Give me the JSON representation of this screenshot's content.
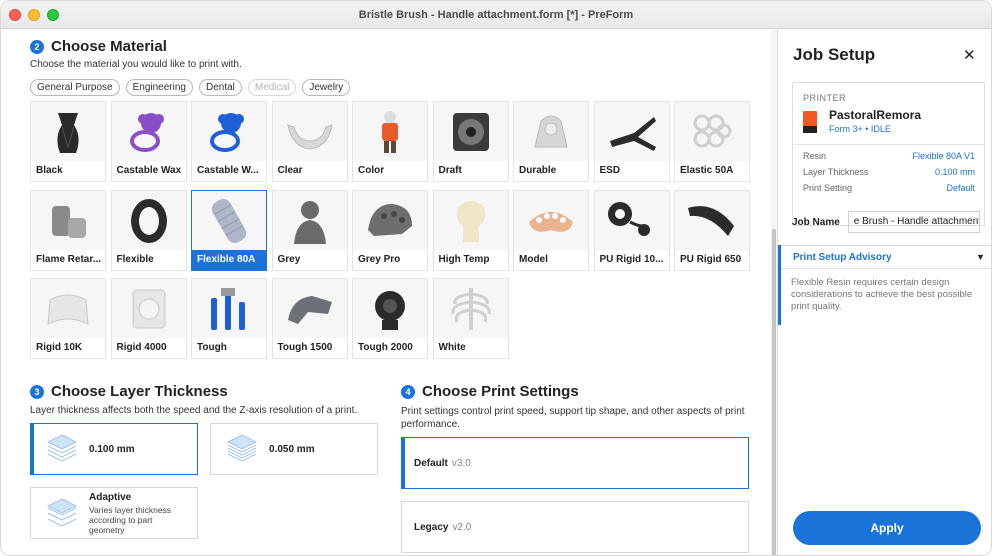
{
  "window": {
    "title": "Bristle Brush - Handle attachment.form [*] - PreForm"
  },
  "material": {
    "step": "2",
    "heading": "Choose Material",
    "description": "Choose the material you would like to print with.",
    "categories": [
      {
        "label": "General Purpose",
        "enabled": true
      },
      {
        "label": "Engineering",
        "enabled": true
      },
      {
        "label": "Dental",
        "enabled": true
      },
      {
        "label": "Medical",
        "enabled": false
      },
      {
        "label": "Jewelry",
        "enabled": true
      }
    ],
    "items": [
      {
        "label": "Black",
        "icon": "vase-icon",
        "color": "#2a2a2a"
      },
      {
        "label": "Castable Wax",
        "icon": "ring-icon",
        "color": "#8a4ec7"
      },
      {
        "label": "Castable W...",
        "icon": "ring-icon",
        "color": "#1f5fd6"
      },
      {
        "label": "Clear",
        "icon": "jaw-icon",
        "color": "#d8d8d8"
      },
      {
        "label": "Color",
        "icon": "figure-icon",
        "color": "#e85a2a"
      },
      {
        "label": "Draft",
        "icon": "fan-icon",
        "color": "#3a3a3a"
      },
      {
        "label": "Durable",
        "icon": "part-icon",
        "color": "#d6d6d6"
      },
      {
        "label": "ESD",
        "icon": "clip-icon",
        "color": "#2b2b2b"
      },
      {
        "label": "Elastic 50A",
        "icon": "lattice-icon",
        "color": "#cfcfcf"
      },
      {
        "label": "Flame Retar...",
        "icon": "block-icon",
        "color": "#8a8a8a"
      },
      {
        "label": "Flexible",
        "icon": "tire-icon",
        "color": "#2b2b2b"
      },
      {
        "label": "Flexible 80A",
        "icon": "tube-icon",
        "color": "#aeb6c8"
      },
      {
        "label": "Grey",
        "icon": "bust-icon",
        "color": "#6a6a6a"
      },
      {
        "label": "Grey Pro",
        "icon": "helmet-icon",
        "color": "#6e6e6e"
      },
      {
        "label": "High Temp",
        "icon": "bulb-icon",
        "color": "#efe6c8"
      },
      {
        "label": "Model",
        "icon": "teeth-icon",
        "color": "#e8b48f"
      },
      {
        "label": "PU Rigid 10...",
        "icon": "cable-icon",
        "color": "#2b2b2b"
      },
      {
        "label": "PU Rigid 650",
        "icon": "chain-icon",
        "color": "#2b2b2b"
      },
      {
        "label": "Rigid 10K",
        "icon": "bracket-icon",
        "color": "#e6e6e6"
      },
      {
        "label": "Rigid 4000",
        "icon": "grille-icon",
        "color": "#e6e6e6"
      },
      {
        "label": "Tough",
        "icon": "tools-icon",
        "color": "#1f5fd6"
      },
      {
        "label": "Tough 1500",
        "icon": "handle-icon",
        "color": "#6e7078"
      },
      {
        "label": "Tough 2000",
        "icon": "pump-icon",
        "color": "#2b2b2b"
      },
      {
        "label": "White",
        "icon": "ribcage-icon",
        "color": "#e8e8e8"
      }
    ],
    "selected": "Flexible 80A"
  },
  "layer": {
    "step": "3",
    "heading": "Choose Layer Thickness",
    "description": "Layer thickness affects both the speed and the Z-axis resolution of a print.",
    "options": [
      {
        "label": "0.100 mm",
        "selected": true
      },
      {
        "label": "0.050 mm",
        "selected": false
      }
    ],
    "adaptive": {
      "label": "Adaptive",
      "description": "Varies layer thickness according to part geometry"
    }
  },
  "print_settings": {
    "step": "4",
    "heading": "Choose Print Settings",
    "description": "Print settings control print speed, support tip shape, and other aspects of print performance.",
    "options": [
      {
        "name": "Default",
        "version": "v3.0",
        "selected": true
      },
      {
        "name": "Legacy",
        "version": "v2.0",
        "selected": false
      }
    ]
  },
  "job_setup": {
    "heading": "Job Setup",
    "close": "✕",
    "printer_caption": "PRINTER",
    "printer_name": "PastoralRemora",
    "printer_status": "Form 3+ • IDLE",
    "rows": [
      {
        "k": "Resin",
        "v": "Flexible 80A V1"
      },
      {
        "k": "Layer Thickness",
        "v": "0.100 mm"
      },
      {
        "k": "Print Setting",
        "v": "Default"
      }
    ],
    "job_name_label": "Job Name",
    "job_name_value": "e Brush - Handle attachment",
    "advisory_title": "Print Setup Advisory",
    "advisory_text": "Flexible Resin requires certain design considerations to achieve the best possible print quality.",
    "apply": "Apply"
  },
  "colors": {
    "accent": "#1a73d9"
  }
}
